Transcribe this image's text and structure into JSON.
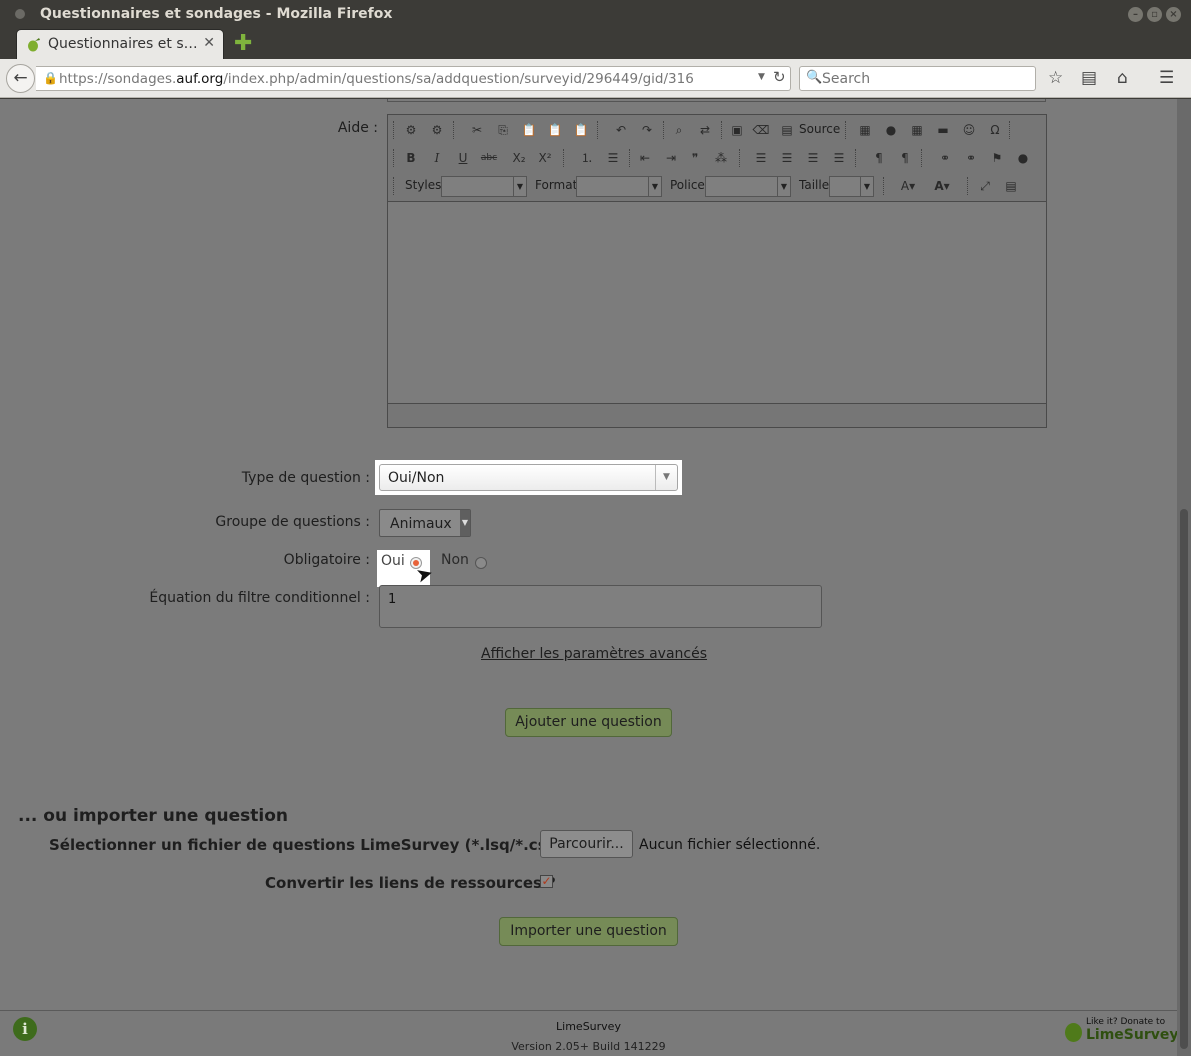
{
  "window": {
    "title": "Questionnaires et sondages - Mozilla Firefox"
  },
  "tab": {
    "title": "Questionnaires et s…"
  },
  "navbar": {
    "url_prefix": "https://sondages.",
    "url_domain": "auf.org",
    "url_path": "/index.php/admin/questions/sa/addquestion/surveyid/296449/gid/316",
    "search_placeholder": "Search"
  },
  "form": {
    "help_label": "Aide :",
    "editor": {
      "source_label": "Source",
      "styles_label": "Styles",
      "format_label": "Format",
      "police_label": "Police",
      "taille_label": "Taille"
    },
    "question_type_label": "Type de question :",
    "question_type_value": "Oui/Non",
    "question_group_label": "Groupe de questions :",
    "question_group_value": "Animaux",
    "mandatory_label": "Obligatoire :",
    "mandatory_yes": "Oui",
    "mandatory_no": "Non",
    "condition_label": "Équation du filtre conditionnel :",
    "condition_value": "1",
    "advanced_link": "Afficher les paramètres avancés",
    "add_button": "Ajouter une question"
  },
  "import": {
    "title": "... ou importer une question",
    "file_label": "Sélectionner un fichier de questions LimeSurvey (*.lsq/*.csv):",
    "browse_button": "Parcourir...",
    "no_file": "Aucun fichier sélectionné.",
    "convert_label": "Convertir les liens de ressources ?",
    "import_button": "Importer une question"
  },
  "footer": {
    "app_name": "LimeSurvey",
    "version": "Version 2.05+ Build 141229",
    "donate_text": "Like it? Donate to",
    "donate_brand": "LimeSurvey"
  },
  "colors": {
    "accent_radio": "#e8633a",
    "button_green": "#768b57",
    "checkbox_mark": "#b0391b"
  }
}
